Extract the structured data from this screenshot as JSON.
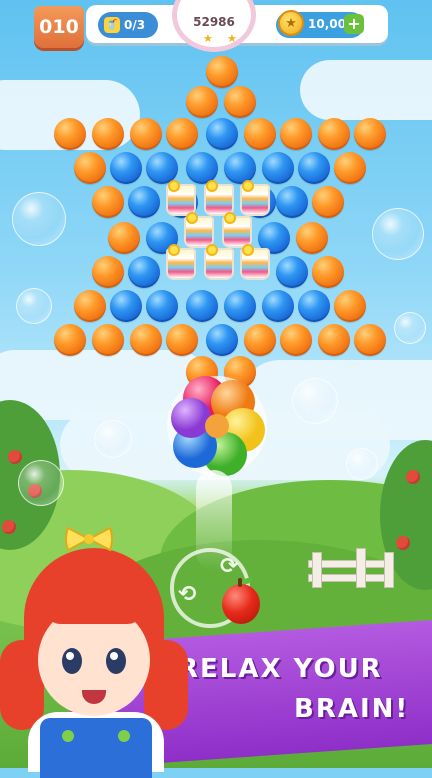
{
  "hud": {
    "level": "010",
    "goal_count": "0/3",
    "goal_icon": "cup-icon",
    "score": "52986",
    "stars_earned": 2,
    "coins": "10,00",
    "plus": "+"
  },
  "banner": {
    "line1": "RELAX YOUR",
    "line2": "BRAIN!"
  },
  "colors": {
    "orange_bubble": "#ff9a2a",
    "blue_bubble": "#1f78e0",
    "banner_purple": "#9d3fd0",
    "level_badge": "#ef8547"
  },
  "shooter": {
    "current_ball": "rainbow-ball",
    "next_ball": "apple-ball"
  }
}
